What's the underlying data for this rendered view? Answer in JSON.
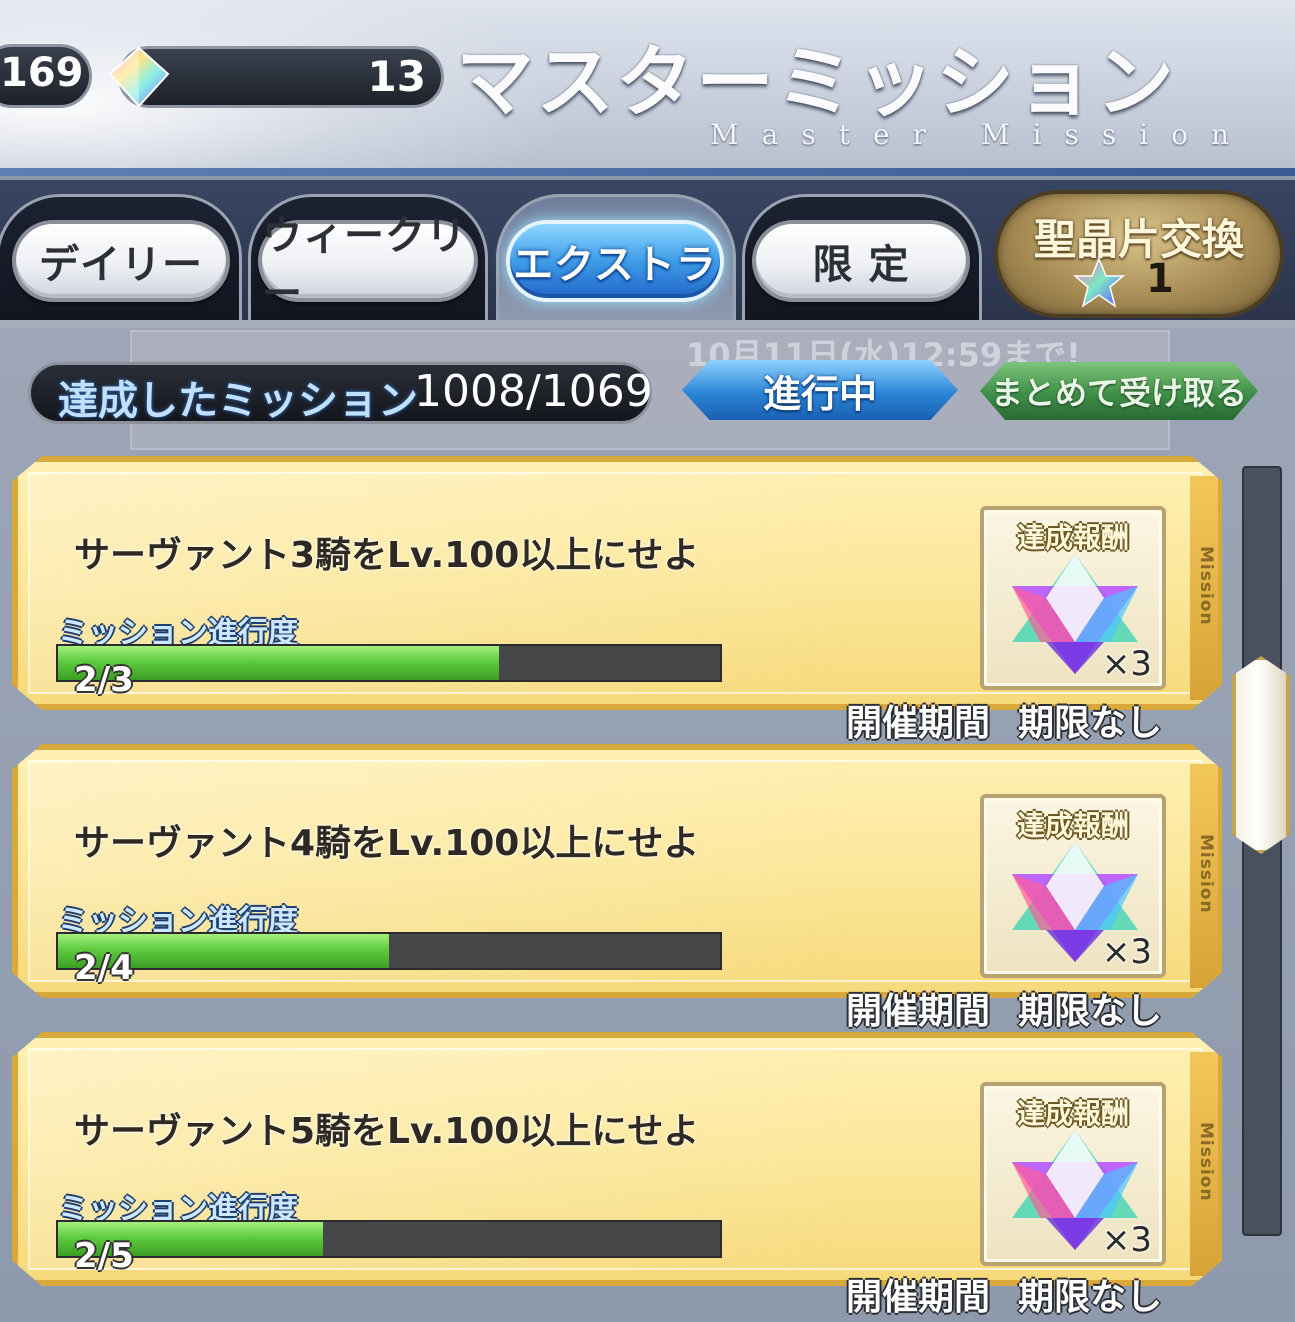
{
  "header": {
    "left_counter": "169",
    "saint_quartz_count": "13",
    "title": "マスターミッション",
    "subtitle": "Master Mission"
  },
  "tabs": [
    {
      "label": "デイリー",
      "active": false
    },
    {
      "label": "ウィークリー",
      "active": false
    },
    {
      "label": "エクストラ",
      "active": true
    },
    {
      "label": "限 定",
      "active": false
    }
  ],
  "exchange": {
    "label": "聖晶片交換",
    "count": "1"
  },
  "banner_text": "10月11日(水)12:59まで!",
  "summary": {
    "achieved_label": "達成したミッション",
    "achieved_value": "1008/1069",
    "status_button": "進行中",
    "claim_all_button": "まとめて受け取る"
  },
  "missions": [
    {
      "text": "サーヴァント3騎をLv.100以上にせよ",
      "progress_label": "ミッション進行度",
      "progress": "2/3",
      "progress_fraction": 0.6667,
      "reward_label": "達成報酬",
      "reward_qty": "×3",
      "period_label": "開催期間",
      "period_value": "期限なし",
      "side_label": "Mission"
    },
    {
      "text": "サーヴァント4騎をLv.100以上にせよ",
      "progress_label": "ミッション進行度",
      "progress": "2/4",
      "progress_fraction": 0.5,
      "reward_label": "達成報酬",
      "reward_qty": "×3",
      "period_label": "開催期間",
      "period_value": "期限なし",
      "side_label": "Mission"
    },
    {
      "text": "サーヴァント5騎をLv.100以上にせよ",
      "progress_label": "ミッション進行度",
      "progress": "2/5",
      "progress_fraction": 0.4,
      "reward_label": "達成報酬",
      "reward_qty": "×3",
      "period_label": "開催期間",
      "period_value": "期限なし",
      "side_label": "Mission"
    }
  ],
  "icons": {
    "currency": "saint-quartz-icon",
    "reward": "saint-quartz-star-icon",
    "fragment": "saint-quartz-fragment-icon"
  },
  "colors": {
    "active_tab": "#3f9de8",
    "progress_fill": "#5fcc3e",
    "card_gold": "#d9a83a",
    "card_bg": "#fce79a"
  }
}
